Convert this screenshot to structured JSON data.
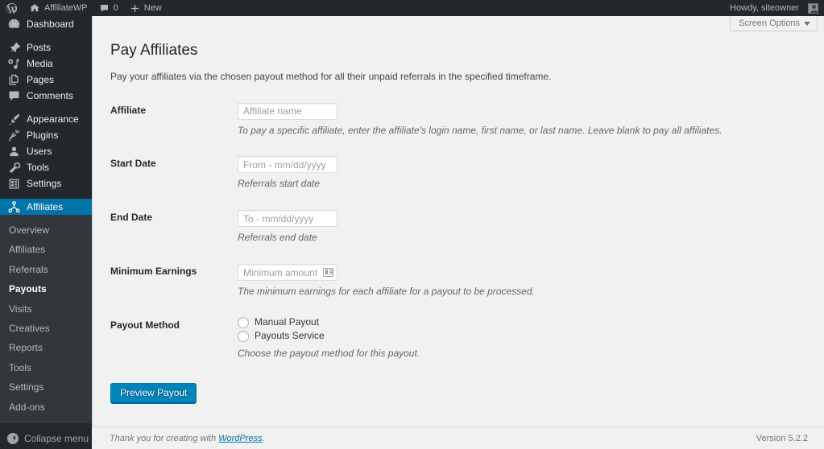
{
  "colors": {
    "admin_bar_bg": "#23282d",
    "sidebar_bg": "#23282d",
    "submenu_bg": "#32373c",
    "accent_blue": "#0073aa",
    "button_blue": "#0085ba",
    "content_bg": "#f1f1f1"
  },
  "admin_bar": {
    "wp_logo": "wordpress-logo-icon",
    "site_name": "AffiliateWP",
    "site_icon": "home-icon",
    "comments_icon": "comment-bubble-icon",
    "comments_count": "0",
    "new_icon": "plus-icon",
    "new_label": "New",
    "howdy": "Howdy, siteowner",
    "avatar": "user-avatar-icon"
  },
  "sidebar": {
    "items": [
      {
        "label": "Dashboard",
        "icon": "dashboard-icon",
        "current": false
      },
      {
        "label": "Posts",
        "icon": "pin-icon",
        "current": false
      },
      {
        "label": "Media",
        "icon": "media-icon",
        "current": false
      },
      {
        "label": "Pages",
        "icon": "pages-icon",
        "current": false
      },
      {
        "label": "Comments",
        "icon": "comment-bubble-icon",
        "current": false
      },
      {
        "label": "Appearance",
        "icon": "paintbrush-icon",
        "current": false
      },
      {
        "label": "Plugins",
        "icon": "plug-icon",
        "current": false
      },
      {
        "label": "Users",
        "icon": "user-icon",
        "current": false
      },
      {
        "label": "Tools",
        "icon": "wrench-icon",
        "current": false
      },
      {
        "label": "Settings",
        "icon": "settings-sliders-icon",
        "current": false
      },
      {
        "label": "Affiliates",
        "icon": "affiliates-network-icon",
        "current": true
      }
    ],
    "submenu": [
      {
        "label": "Overview",
        "current": false
      },
      {
        "label": "Affiliates",
        "current": false
      },
      {
        "label": "Referrals",
        "current": false
      },
      {
        "label": "Payouts",
        "current": true
      },
      {
        "label": "Visits",
        "current": false
      },
      {
        "label": "Creatives",
        "current": false
      },
      {
        "label": "Reports",
        "current": false
      },
      {
        "label": "Tools",
        "current": false
      },
      {
        "label": "Settings",
        "current": false
      },
      {
        "label": "Add-ons",
        "current": false
      }
    ],
    "collapse_label": "Collapse menu",
    "collapse_icon": "arrow-left-circle-icon"
  },
  "screen_meta": {
    "screen_options_label": "Screen Options",
    "caret_icon": "chevron-down-icon"
  },
  "page": {
    "title": "Pay Affiliates",
    "description": "Pay your affiliates via the chosen payout method for all their unpaid referrals in the specified timeframe."
  },
  "form": {
    "affiliate": {
      "label": "Affiliate",
      "placeholder": "Affiliate name",
      "value": "",
      "description": "To pay a specific affiliate, enter the affiliate's login name, first name, or last name. Leave blank to pay all affiliates."
    },
    "start_date": {
      "label": "Start Date",
      "placeholder": "From - mm/dd/yyyy",
      "value": "",
      "description": "Referrals start date"
    },
    "end_date": {
      "label": "End Date",
      "placeholder": "To - mm/dd/yyyy",
      "value": "",
      "description": "Referrals end date"
    },
    "minimum_earnings": {
      "label": "Minimum Earnings",
      "placeholder": "Minimum amount",
      "value": "",
      "autofill_icon": "autofill-card-icon",
      "description": "The minimum earnings for each affiliate for a payout to be processed."
    },
    "payout_method": {
      "label": "Payout Method",
      "options": [
        {
          "label": "Manual Payout",
          "checked": false
        },
        {
          "label": "Payouts Service",
          "checked": false
        }
      ],
      "description": "Choose the payout method for this payout."
    },
    "submit_label": "Preview Payout"
  },
  "footer": {
    "thanks_prefix": "Thank you for creating with ",
    "thanks_link": "WordPress",
    "thanks_suffix": ".",
    "version": "Version 5.2.2"
  }
}
